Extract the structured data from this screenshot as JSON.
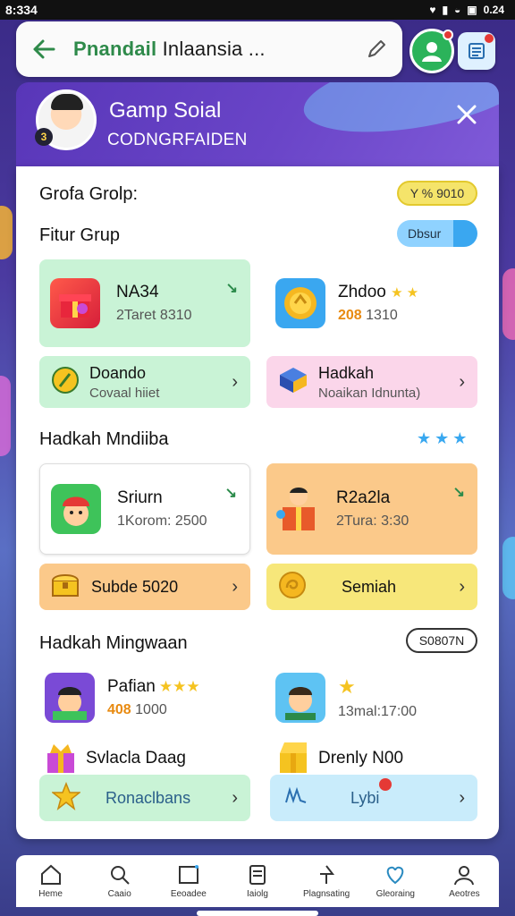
{
  "status_bar": {
    "time": "8:334",
    "right_text": "0.24"
  },
  "search": {
    "prefix": "Pnandail",
    "rest": " Inlaansia ..."
  },
  "header": {
    "title": "Gamp Soial",
    "subtitle": "CODNGRFAIDEN",
    "avatar_badge": "3"
  },
  "section1": {
    "title": "Grofa Grolp:",
    "pill": "Y % 9010"
  },
  "section2": {
    "title": "Fitur Grup",
    "pill": "Dbsur"
  },
  "tiles_a": [
    {
      "title": "NA34",
      "sub": "2Taret 8310",
      "icon": "gift-icon"
    },
    {
      "title": "Zhdoo",
      "stars": "★ ★",
      "sub_accent": "208",
      "sub": " 1310",
      "icon": "coin-icon"
    }
  ],
  "buttons_a": [
    {
      "title": "Doando",
      "sub": "Covaal hiiet",
      "icon": "shield-icon"
    },
    {
      "title": "Hadkah",
      "sub": "Noaikan Idnunta)",
      "icon": "cube-icon"
    }
  ],
  "section3": {
    "title": "Hadkah Mndiiba",
    "stars": "★★★"
  },
  "tiles_b": [
    {
      "title": "Sriurn",
      "sub": "1Korom: 2500",
      "icon": "player-avatar-icon"
    },
    {
      "title": "R2a2la",
      "sub": "2Tura: 3:30",
      "icon": "gift-box-avatar-icon"
    }
  ],
  "buttons_b": [
    {
      "label": "Subde 5020",
      "icon": "chest-icon"
    },
    {
      "label": "Semiah",
      "icon": "coin-swirl-icon"
    }
  ],
  "section4": {
    "title": "Hadkah Mingwaan",
    "pill": "S0807N"
  },
  "people": [
    {
      "name": "Pafian",
      "stars": "★★★",
      "sub_accent": "408",
      "sub": " 1000"
    },
    {
      "name": "",
      "stars": "★",
      "sub": "13mal:17:00"
    }
  ],
  "gifts": [
    {
      "title": "Svlacla Daag"
    },
    {
      "title": "Drenly N00"
    }
  ],
  "buttons_c": [
    {
      "label": "Ronaclbans",
      "icon": "star-icon"
    },
    {
      "label": "Lybi",
      "icon": "chat-icon"
    }
  ],
  "nav": [
    {
      "label": "Heme",
      "icon": "home-icon"
    },
    {
      "label": "Caaio",
      "icon": "search-icon"
    },
    {
      "label": "Eeoadee",
      "icon": "board-icon"
    },
    {
      "label": "Iaiolg",
      "icon": "layers-icon"
    },
    {
      "label": "Plagnsating",
      "icon": "pin-icon"
    },
    {
      "label": "Gleoraing",
      "icon": "heart-icon"
    },
    {
      "label": "Aeotres",
      "icon": "user-icon"
    }
  ],
  "colors": {
    "accent_green": "#2e8a4a",
    "header_purple": "#5836b8",
    "tile_green": "#c9f3d6",
    "tile_pink": "#fbd6ea",
    "tile_orange": "#fbc98a",
    "tile_cyan": "#c9ecfb"
  }
}
